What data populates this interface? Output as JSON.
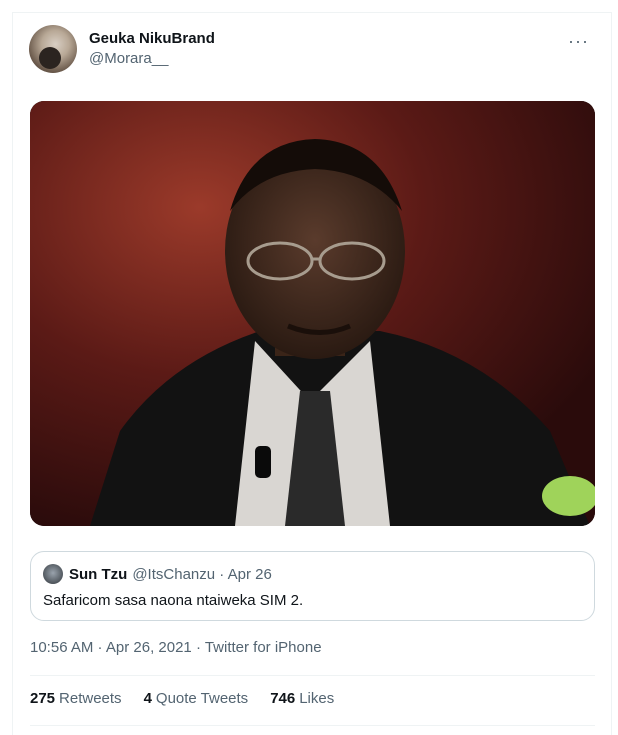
{
  "tweet": {
    "author": {
      "display_name": "Geuka NikuBrand",
      "handle": "@Morara__"
    },
    "more_icon": "ellipsis-icon",
    "media": {
      "type": "photo"
    },
    "quoted_tweet": {
      "name": "Sun Tzu",
      "meta": "@ItsChanzu · Apr 26",
      "text": "Safaricom sasa naona ntaiweka SIM 2."
    },
    "timestamp": "10:56 AM · Apr 26, 2021 · Twitter for iPhone",
    "stats": [
      {
        "count": "275",
        "label": "Retweets"
      },
      {
        "count": "4",
        "label": "Quote Tweets"
      },
      {
        "count": "746",
        "label": "Likes"
      }
    ]
  },
  "colors": {
    "muted": "#536471",
    "border": "#cfd9de",
    "text": "#0f1419"
  }
}
